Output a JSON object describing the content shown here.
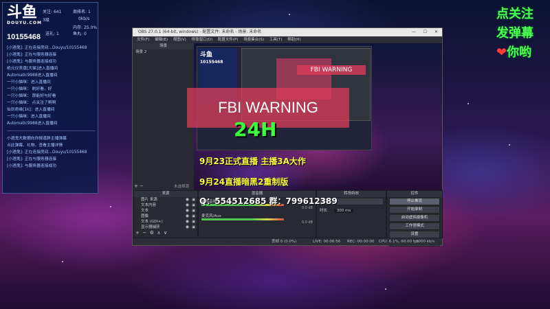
{
  "chat": {
    "logo_main": "斗鱼",
    "logo_sub": "DOUYU.COM",
    "stats": {
      "followers_label": "关注:",
      "followers_value": "641",
      "rank_label": "周排名:",
      "rank_value": "1",
      "badge_label": "3级",
      "bitrate_value": "0kb/s",
      "cpu_label": "内存:",
      "cpu_value": "25.0%",
      "gift_label": "送礼:",
      "gift_value": "1",
      "fish_label": "鱼丸:",
      "fish_value": "0"
    },
    "room_id": "10155468",
    "messages_top": [
      "[小酒鬼]: 正在连接房间...Douyu/10155468",
      "[小酒鬼]: 正在与服务器连接",
      "[小酒鬼]: 与服务器连接成功",
      "绝元仪表盘[大猫]进入直播间",
      "Automatic9988进入直播间",
      "一只小猫咪：进入直播间",
      "一只小猫咪：   刷好看，好",
      "一只小猫咪：   那能好与好看",
      "一只小猫咪：   点关注了啊啊",
      "仙剑奇缘[1k]：进入直播间",
      "一只小猫咪：进入直播间",
      "Automatic9988进入直播间"
    ],
    "messages_bottom": [
      "小酒鬼大数据向你报道胖主播弹幕",
      "点此弹幕、礼物、查看主播详情",
      "[小酒鬼]: 正在连接房间...Douyu/10155468",
      "[小酒鬼]: 正在与服务器连接",
      "[小酒鬼]: 与服务器连接成功"
    ]
  },
  "overlay": {
    "line1": "点关注",
    "line2": "发弹幕",
    "line3": "你哟",
    "heart": "❤"
  },
  "obs": {
    "title": "OBS 27.0.1 (64-bit, windows) - 配置文件: 未命名 - 场景: 未命名",
    "menu": [
      "文件(F)",
      "编辑(E)",
      "视图(V)",
      "停靠窗口(D)",
      "配置文件(P)",
      "场景集合(S)",
      "工具(T)",
      "帮助(H)"
    ],
    "scenes_header": "场景",
    "scene_item": "场景 2",
    "sources_header": "来源",
    "sources": [
      "图片 来源",
      "文本内容",
      "文本",
      "图像",
      "文本 (GDI+)",
      "显示器捕获"
    ],
    "mixer_header": "混音器",
    "mixer_channels": [
      {
        "name": "桌面音频",
        "db": "0.0 dB"
      },
      {
        "name": "麦克风/Aux",
        "db": "0.0 dB"
      }
    ],
    "transition_header": "转场特效",
    "transition_value": "淡出",
    "duration_label": "时长",
    "duration_value": "300 ms",
    "controls_header": "控件",
    "controls": [
      "停止推流",
      "开始录制",
      "启动虚拟摄像机",
      "工作室模式",
      "设置",
      "退出"
    ],
    "filter_label": "未选择源",
    "status": {
      "dropped": "丢帧 0 (0.0%)",
      "live": "LIVE: 00:06:56",
      "rec": "REC: 00:00:00",
      "cpu": "CPU: 6.1%, 60.00 fps",
      "kbps": "3000 kb/s"
    }
  },
  "preview": {
    "fbi": "FBI WARNING",
    "big": "24H",
    "promo1": "9月23正式直播 主播3A大作",
    "promo2": "9月24直播暗黑2重制版",
    "promo3": "Q：554512685  群：799612389",
    "small_fbi": "FBI WARNING"
  }
}
